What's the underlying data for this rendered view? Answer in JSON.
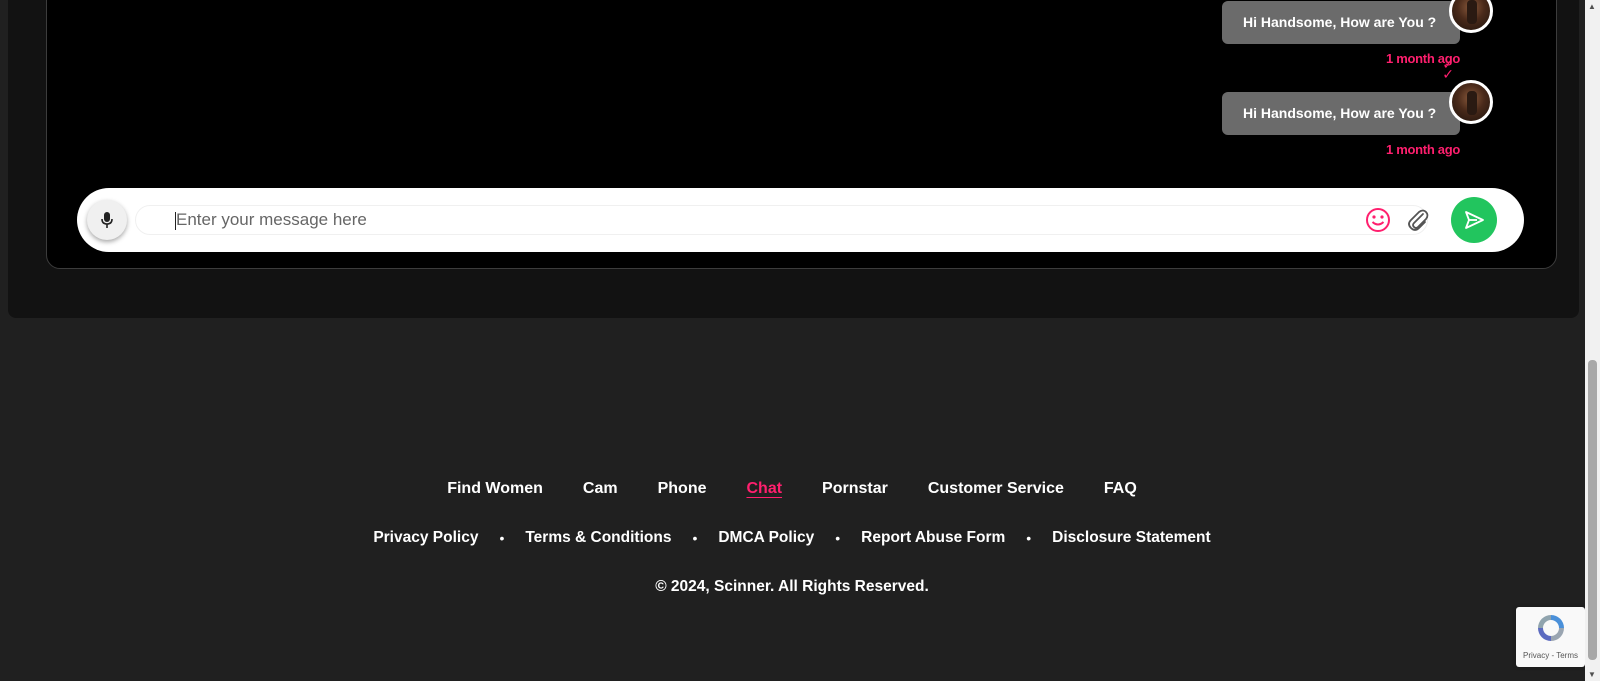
{
  "chat": {
    "messages": [
      {
        "text": "Hi Handsome, How are You ?",
        "time": "1 month ago"
      },
      {
        "text": "Hi Handsome, How are You ?",
        "time": "1 month ago"
      }
    ],
    "input_placeholder": "Enter your message here",
    "icons": {
      "mic": "microphone-icon",
      "emoji": "smiley-icon",
      "attach": "paperclip-icon",
      "send": "send-arrow-icon"
    },
    "colors": {
      "accent": "#ff1f6e",
      "send": "#22c55e",
      "bubble": "#6b6b6b"
    }
  },
  "footer": {
    "nav": [
      {
        "label": "Find Women"
      },
      {
        "label": "Cam"
      },
      {
        "label": "Phone"
      },
      {
        "label": "Chat",
        "active": true
      },
      {
        "label": "Pornstar"
      },
      {
        "label": "Customer Service"
      },
      {
        "label": "FAQ"
      }
    ],
    "legal": [
      {
        "label": "Privacy Policy"
      },
      {
        "label": "Terms & Conditions"
      },
      {
        "label": "DMCA Policy"
      },
      {
        "label": "Report Abuse Form"
      },
      {
        "label": "Disclosure Statement"
      }
    ],
    "copyright": "© 2024, Scinner. All Rights Reserved."
  },
  "recaptcha": {
    "text": "Privacy - Terms"
  }
}
